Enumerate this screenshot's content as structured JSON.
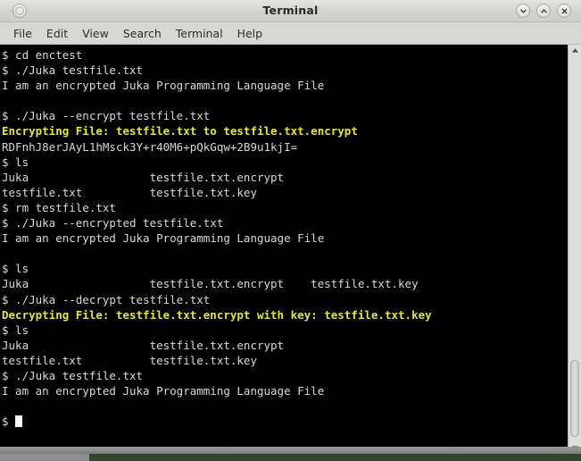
{
  "window": {
    "title": "Terminal",
    "buttons": {
      "menu": "window-menu",
      "minimize": "minimize",
      "maximize": "maximize",
      "close": "close"
    }
  },
  "menubar": {
    "items": [
      {
        "label": "File"
      },
      {
        "label": "Edit"
      },
      {
        "label": "View"
      },
      {
        "label": "Search"
      },
      {
        "label": "Terminal"
      },
      {
        "label": "Help"
      }
    ]
  },
  "colors": {
    "terminal_background": "#000000",
    "terminal_foreground": "#d8d8d8",
    "highlight_yellow": "#e3e34a",
    "chrome": "#d7d7d3",
    "desktop": "#31462b"
  },
  "terminal": {
    "prompt": "$",
    "cursor": "block",
    "lines": [
      {
        "text": "$ cd enctest",
        "color": "default"
      },
      {
        "text": "$ ./Juka testfile.txt",
        "color": "default"
      },
      {
        "text": "I am an encrypted Juka Programming Language File",
        "color": "default"
      },
      {
        "text": "",
        "color": "default"
      },
      {
        "text": "$ ./Juka --encrypt testfile.txt",
        "color": "default"
      },
      {
        "text": "Encrypting File: testfile.txt to testfile.txt.encrypt",
        "color": "yellow"
      },
      {
        "text": "RDFnhJ8erJAyL1hMsck3Y+r40M6+pQkGqw+2B9u1kjI=",
        "color": "default"
      },
      {
        "text": "$ ls",
        "color": "default"
      },
      {
        "text": "Juka                  testfile.txt.encrypt",
        "color": "default"
      },
      {
        "text": "testfile.txt          testfile.txt.key",
        "color": "default"
      },
      {
        "text": "$ rm testfile.txt",
        "color": "default"
      },
      {
        "text": "$ ./Juka --encrypted testfile.txt",
        "color": "default"
      },
      {
        "text": "I am an encrypted Juka Programming Language File",
        "color": "default"
      },
      {
        "text": "",
        "color": "default"
      },
      {
        "text": "$ ls",
        "color": "default"
      },
      {
        "text": "Juka                  testfile.txt.encrypt    testfile.txt.key",
        "color": "default"
      },
      {
        "text": "$ ./Juka --decrypt testfile.txt",
        "color": "default"
      },
      {
        "text": "Decrypting File: testfile.txt.encrypt with key: testfile.txt.key",
        "color": "yellow"
      },
      {
        "text": "$ ls",
        "color": "default"
      },
      {
        "text": "Juka                  testfile.txt.encrypt",
        "color": "default"
      },
      {
        "text": "testfile.txt          testfile.txt.key",
        "color": "default"
      },
      {
        "text": "$ ./Juka testfile.txt",
        "color": "default"
      },
      {
        "text": "I am an encrypted Juka Programming Language File",
        "color": "default"
      },
      {
        "text": "",
        "color": "default"
      },
      {
        "text": "$ ",
        "color": "default",
        "cursor": true
      }
    ]
  }
}
